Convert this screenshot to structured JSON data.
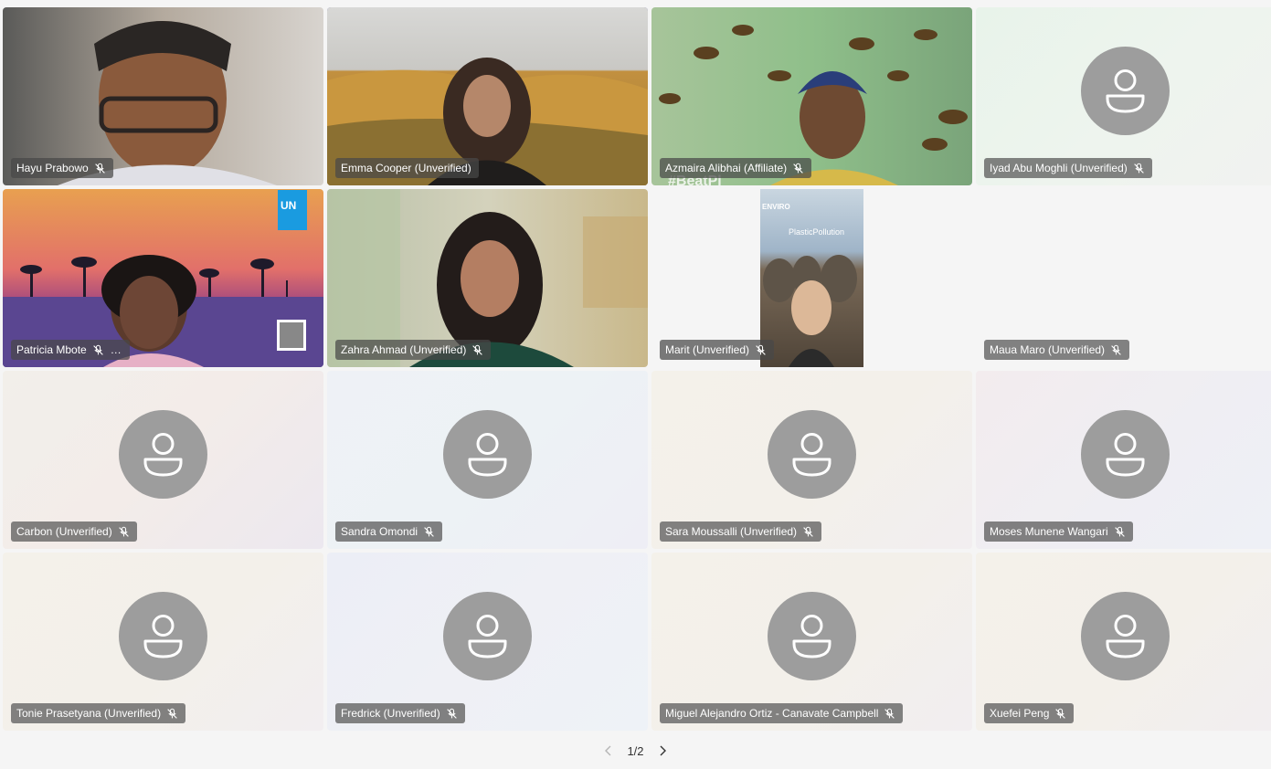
{
  "participants": [
    {
      "name": "Hayu Prabowo",
      "muted": true,
      "video": true,
      "speaking": false
    },
    {
      "name": "Emma Cooper (Unverified)",
      "muted": false,
      "video": true,
      "speaking": true
    },
    {
      "name": "Azmaira Alibhai (Affiliate)",
      "muted": true,
      "video": true,
      "speaking": false
    },
    {
      "name": "Iyad Abu Moghli (Unverified)",
      "muted": true,
      "video": false,
      "speaking": false
    },
    {
      "name": "Patricia Mbote",
      "muted": true,
      "video": true,
      "speaking": false,
      "more_icon": "…"
    },
    {
      "name": "Zahra Ahmad (Unverified)",
      "muted": true,
      "video": true,
      "speaking": false
    },
    {
      "name": "Marit (Unverified)",
      "muted": true,
      "video": true,
      "speaking": false
    },
    {
      "name": "Maua Maro (Unverified)",
      "muted": true,
      "video": false,
      "speaking": false
    },
    {
      "name": "Carbon (Unverified)",
      "muted": true,
      "video": false,
      "speaking": false
    },
    {
      "name": "Sandra Omondi",
      "muted": true,
      "video": false,
      "speaking": false
    },
    {
      "name": "Sara Moussalli (Unverified)",
      "muted": true,
      "video": false,
      "speaking": false
    },
    {
      "name": "Moses Munene Wangari",
      "muted": true,
      "video": false,
      "speaking": false
    },
    {
      "name": "Tonie Prasetyana (Unverified)",
      "muted": true,
      "video": false,
      "speaking": false
    },
    {
      "name": "Fredrick (Unverified)",
      "muted": true,
      "video": false,
      "speaking": false
    },
    {
      "name": "Miguel Alejandro Ortiz - Canavate Campbell",
      "muted": true,
      "video": false,
      "speaking": false
    },
    {
      "name": "Xuefei Peng",
      "muted": true,
      "video": false,
      "speaking": false
    }
  ],
  "video_overlays": {
    "un_logo": "UN",
    "banner_line1": "#BeatPl",
    "banner_line2": "ENVIRO",
    "banner_line3": "PlasticPollution"
  },
  "pagination": {
    "label": "1/2"
  },
  "colors": {
    "speaking_border": "#6264a7",
    "avatar": "#9d9d9d",
    "badge": "#484848"
  }
}
